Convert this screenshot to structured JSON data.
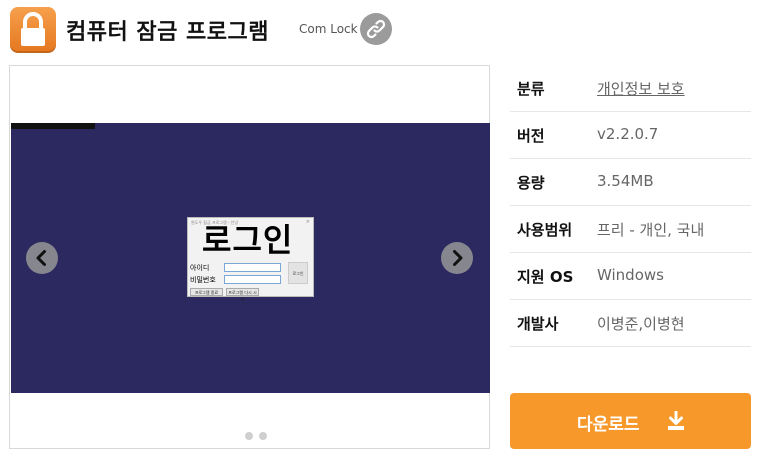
{
  "header": {
    "app_icon": "padlock-icon",
    "title": "컴퓨터 잠금 프로그램",
    "subtitle": "Com Lock",
    "link_icon": "link-icon"
  },
  "carousel": {
    "prev_icon": "chevron-left-icon",
    "next_icon": "chevron-right-icon",
    "screenshot": {
      "dialog_caption": "윈도우 잠금 프로그램 - 안녕",
      "big_text": "로그인",
      "id_label": "아이디",
      "pw_label": "비밀번호",
      "login_button": "로그인",
      "button_1": "프로그램 종료",
      "button_2": "프로그램 다시 시작"
    },
    "dots": 2
  },
  "info": {
    "rows": [
      {
        "key": "분류",
        "value": "개인정보 보호"
      },
      {
        "key": "버전",
        "value": "v2.2.0.7"
      },
      {
        "key": "용량",
        "value": "3.54MB"
      },
      {
        "key": "사용범위",
        "value": "프리 - 개인, 국내"
      },
      {
        "key": "지원 OS",
        "value": "Windows"
      },
      {
        "key": "개발사",
        "value": "이병준,이병현"
      }
    ]
  },
  "download": {
    "label": "다운로드",
    "icon": "download-icon"
  },
  "colors": {
    "accent": "#f7982a",
    "screenshot_bg": "#2c2860",
    "icon_orange": "#ec8228"
  }
}
